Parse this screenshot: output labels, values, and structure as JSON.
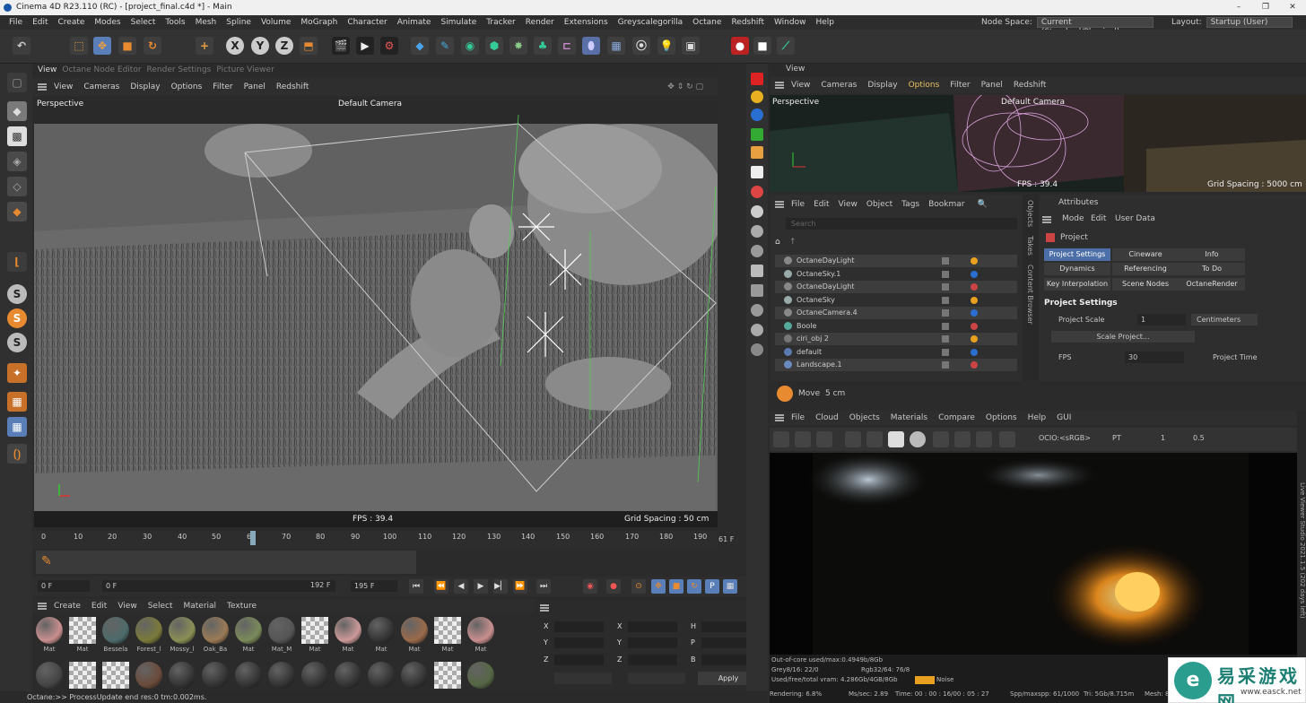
{
  "window": {
    "title": "Cinema 4D R23.110 (RC) - [project_final.c4d *] - Main"
  },
  "menubar": {
    "items": [
      "File",
      "Edit",
      "Create",
      "Modes",
      "Select",
      "Tools",
      "Mesh",
      "Spline",
      "Volume",
      "MoGraph",
      "Character",
      "Animate",
      "Simulate",
      "Tracker",
      "Render",
      "Extensions",
      "Greyscalegorilla",
      "Octane",
      "Redshift",
      "Window",
      "Help"
    ],
    "node_space_label": "Node Space:",
    "node_space_value": "Current (Standard/Physical)",
    "layout_label": "Layout:",
    "layout_value": "Startup (User)"
  },
  "toolbar": {
    "axis_x": "X",
    "axis_y": "Y",
    "axis_z": "Z"
  },
  "left_tools": {
    "s1": "S",
    "s2": "S",
    "s3": "S"
  },
  "viewport": {
    "tabs": [
      "View",
      "Octane Node Editor",
      "Render Settings",
      "Picture Viewer"
    ],
    "menu": [
      "View",
      "Cameras",
      "Display",
      "Options",
      "Filter",
      "Panel",
      "Redshift"
    ],
    "perspective": "Perspective",
    "camera": "Default Camera",
    "fps": "FPS : 39.4",
    "grid": "Grid Spacing : 50 cm"
  },
  "timeline": {
    "ticks": [
      "0",
      "10",
      "20",
      "30",
      "40",
      "50",
      "60",
      "70",
      "80",
      "90",
      "100",
      "110",
      "120",
      "130",
      "140",
      "150",
      "160",
      "170",
      "180",
      "190"
    ],
    "end_frame": "61 F",
    "start_field": "0 F",
    "current_field": "0 F",
    "range_end": "192 F",
    "max_field": "195 F"
  },
  "materials": {
    "menu": [
      "Create",
      "Edit",
      "View",
      "Select",
      "Material",
      "Texture"
    ],
    "row1": [
      "Mat",
      "Mat",
      "Bessela",
      "Forest_l",
      "Mossy_l",
      "Oak_Ba",
      "Mat",
      "Mat_M",
      "Mat",
      "Mat",
      "Mat",
      "Mat",
      "Mat",
      "Mat"
    ],
    "row1_colors": [
      "#c98f8f",
      "checker",
      "#4d6a6a",
      "#7a7a3a",
      "#8a8f55",
      "#9a7a55",
      "#7a8a5a",
      "#555",
      "checker",
      "#c99",
      "#333",
      "#9a6a4a",
      "checker",
      "#c98f8f"
    ],
    "row2_colors": [
      "#444",
      "checker",
      "checker",
      "#6a4a3a",
      "#333",
      "#333",
      "#333",
      "#333",
      "#333",
      "#333",
      "#333",
      "#333",
      "checker",
      "#556644"
    ]
  },
  "coordinates": {
    "labels_pos": [
      "X",
      "Y",
      "Z"
    ],
    "labels_size": [
      "X",
      "Y",
      "Z"
    ],
    "labels_rot": [
      "H",
      "P",
      "B"
    ],
    "apply": "Apply"
  },
  "status": {
    "text": "Octane:>> ProcessUpdate end res:0 tm:0.002ms."
  },
  "right_viewport": {
    "header": "View",
    "menu": [
      "View",
      "Cameras",
      "Display",
      "Options",
      "Filter",
      "Panel",
      "Redshift"
    ],
    "perspective": "Perspective",
    "camera": "Default Camera",
    "fps": "FPS : 39.4",
    "grid": "Grid Spacing : 5000 cm"
  },
  "objects": {
    "menu": [
      "File",
      "Edit",
      "View",
      "Object",
      "Tags",
      "Bookmar"
    ],
    "search_placeholder": "Search",
    "items": [
      {
        "name": "OctaneDayLight",
        "color": "#888"
      },
      {
        "name": "OctaneSky.1",
        "color": "#9aa"
      },
      {
        "name": "OctaneDayLight",
        "color": "#888"
      },
      {
        "name": "OctaneSky",
        "color": "#9aa"
      },
      {
        "name": "OctaneCamera.4",
        "color": "#888"
      },
      {
        "name": "Boole",
        "color": "#5a9"
      },
      {
        "name": "ciri_obj 2",
        "color": "#777"
      },
      {
        "name": "default",
        "color": "#5a7ab0"
      },
      {
        "name": "Landscape.1",
        "color": "#6a8ac0"
      }
    ],
    "side_tabs": [
      "Objects",
      "Takes",
      "Content Browser"
    ]
  },
  "attributes": {
    "header": "Attributes",
    "menu": [
      "Mode",
      "Edit",
      "User Data"
    ],
    "project": "Project",
    "tabs": [
      "Project Settings",
      "Cineware",
      "Info",
      "Dynamics",
      "Referencing",
      "To Do",
      "Key Interpolation",
      "Scene Nodes",
      "OctaneRender"
    ],
    "section": "Project Settings",
    "scale_label": "Project Scale",
    "scale_value": "1",
    "scale_unit": "Centimeters",
    "scale_button": "Scale Project...",
    "fps_label": "FPS",
    "fps_value": "30",
    "time_label": "Project Time"
  },
  "move": {
    "label": "Move",
    "value": "5 cm"
  },
  "octane_viewer": {
    "menu": [
      "File",
      "Cloud",
      "Objects",
      "Materials",
      "Compare",
      "Options",
      "Help",
      "GUI"
    ],
    "ocio": "OCIO:<sRGB>",
    "mode": "PT",
    "samples": "1",
    "value": "0.5",
    "vertical_tab": "Live Viewer Studio 2021.1.5 (202 days left)",
    "stats": {
      "ooc": "Out-of-core used/max:0.4949b/8Gb",
      "grey": "Grey8/16: 22/0",
      "rgb": "Rgb32/64: 76/8",
      "vram": "Used/free/total vram: 4.286Gb/4GB/8Gb",
      "noise": "Noise",
      "rendering": "Rendering: 6.8%",
      "ms": "Ms/sec: 2.89",
      "time": "Time: 00 : 00 : 16/00 : 05 : 27",
      "spp": "Spp/maxspp: 61/1000",
      "tri": "Tri: 5Gb/8.715m",
      "mesh": "Mesh: 856",
      "hair": "Hair: 0",
      "rtx": "RTX"
    }
  },
  "watermark": {
    "cn": "易采游戏网",
    "url": "www.easck.net"
  }
}
